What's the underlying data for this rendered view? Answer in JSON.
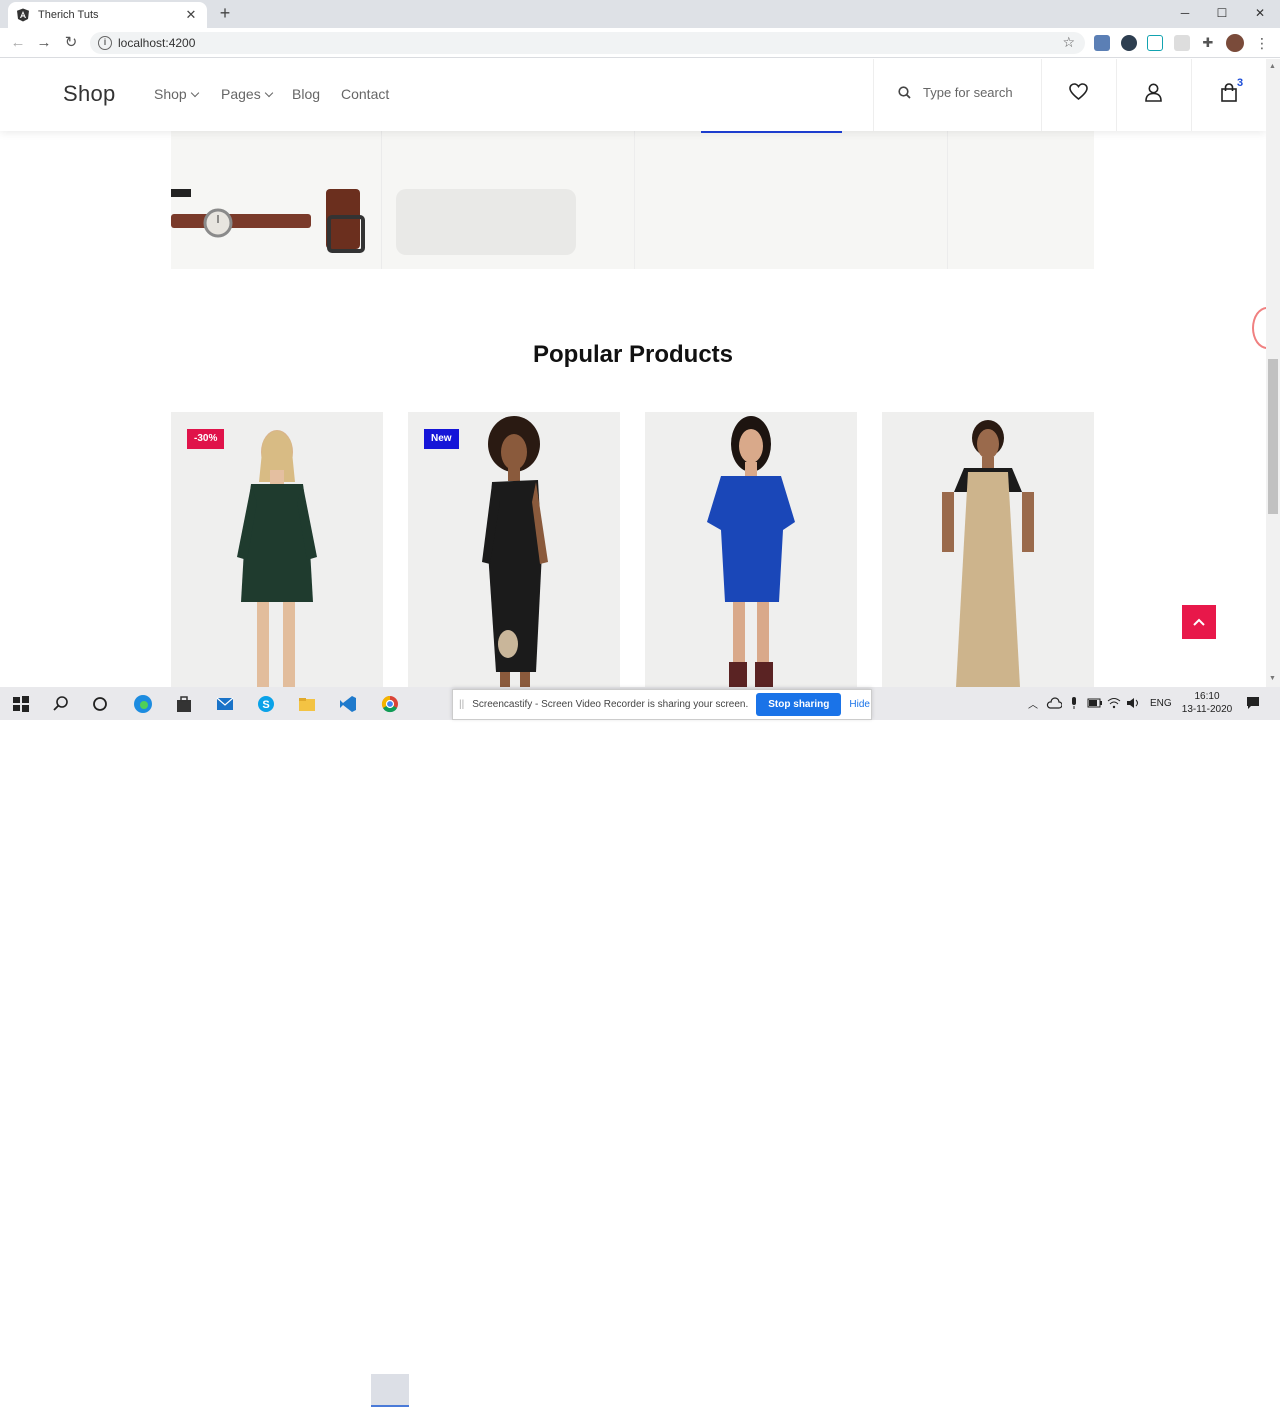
{
  "browser": {
    "tab_title": "Therich Tuts",
    "url": "localhost:4200",
    "new_tab_label": "+",
    "minimize": "─",
    "maximize": "☐",
    "close": "✕"
  },
  "header": {
    "logo": "Shop",
    "nav": [
      {
        "label": "Shop",
        "dropdown": true
      },
      {
        "label": "Pages",
        "dropdown": true
      },
      {
        "label": "Blog",
        "dropdown": false
      },
      {
        "label": "Contact",
        "dropdown": false
      }
    ],
    "search_placeholder": "Type for search",
    "cart_count": "3",
    "icons": [
      "search-icon",
      "heart-icon",
      "user-icon",
      "cart-icon"
    ]
  },
  "section": {
    "title": "Popular Products"
  },
  "products": [
    {
      "badge": "-30%",
      "badge_color": "#e0134a",
      "dress_color": "#1f3b2e"
    },
    {
      "badge": "New",
      "badge_color": "#1515d8",
      "dress_color": "#1b1b1b"
    },
    {
      "badge": "",
      "badge_color": "",
      "dress_color": "#1a47b8"
    },
    {
      "badge": "",
      "badge_color": "",
      "dress_color": "#cdb48c"
    }
  ],
  "colors": {
    "accent_red": "#e8184a",
    "accent_blue": "#1e40d8"
  },
  "taskbar": {
    "share_message": "Screencastify - Screen Video Recorder is sharing your screen.",
    "stop_sharing": "Stop sharing",
    "hide": "Hide",
    "language": "ENG",
    "time": "16:10",
    "date": "13-11-2020"
  }
}
